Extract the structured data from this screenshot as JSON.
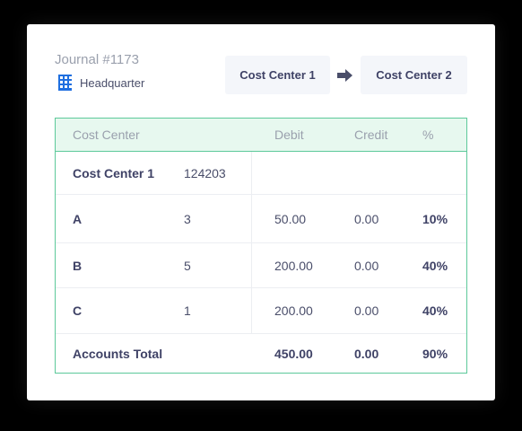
{
  "journal": "Journal #1173",
  "location": {
    "icon": "building-icon",
    "label": "Headquarter"
  },
  "transfer": {
    "from": "Cost Center 1",
    "to": "Cost Center 2",
    "icon": "arrow-right-icon"
  },
  "colors": {
    "accent": "#5cc99a",
    "header_bg": "#e7f8ef",
    "text": "#3f4266",
    "icon": "#1f6fe0"
  },
  "table": {
    "headers": [
      "Cost Center",
      "Debit",
      "Credit",
      "%"
    ],
    "group": {
      "name": "Cost Center 1",
      "code": "124203"
    },
    "rows": [
      {
        "name": "A",
        "qty": "3",
        "debit": "50.00",
        "credit": "0.00",
        "pct": "10%"
      },
      {
        "name": "B",
        "qty": "5",
        "debit": "200.00",
        "credit": "0.00",
        "pct": "40%"
      },
      {
        "name": "C",
        "qty": "1",
        "debit": "200.00",
        "credit": "0.00",
        "pct": "40%"
      }
    ],
    "total": {
      "label": "Accounts Total",
      "debit": "450.00",
      "credit": "0.00",
      "pct": "90%"
    }
  }
}
